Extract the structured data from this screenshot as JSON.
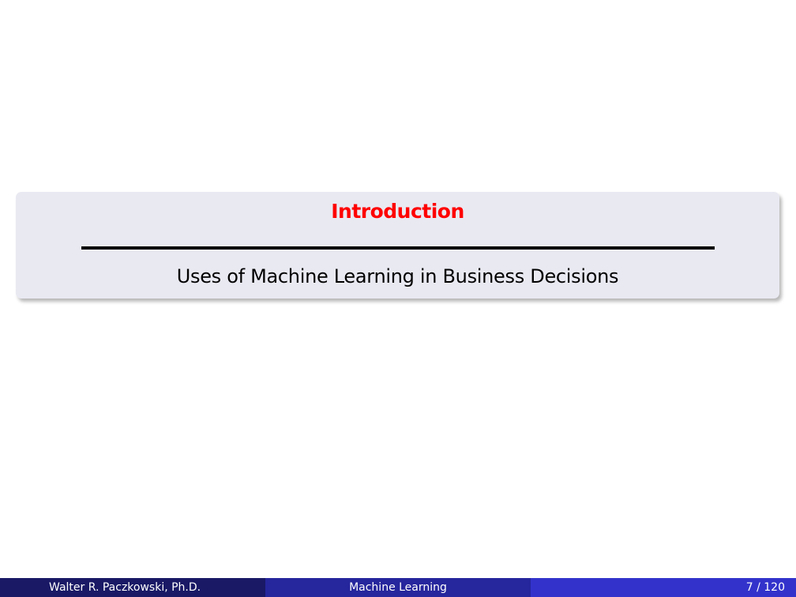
{
  "section": {
    "title": "Introduction",
    "subtitle": "Uses of Machine Learning in Business Decisions"
  },
  "footer": {
    "author": "Walter R. Paczkowski, Ph.D.",
    "title": "Machine Learning",
    "page": "7 / 120"
  },
  "colors": {
    "section_title": "#ff0000",
    "box_background": "#e9e9f2",
    "footer_left": "#191966",
    "footer_center": "#26269d",
    "footer_right": "#3333cc"
  }
}
